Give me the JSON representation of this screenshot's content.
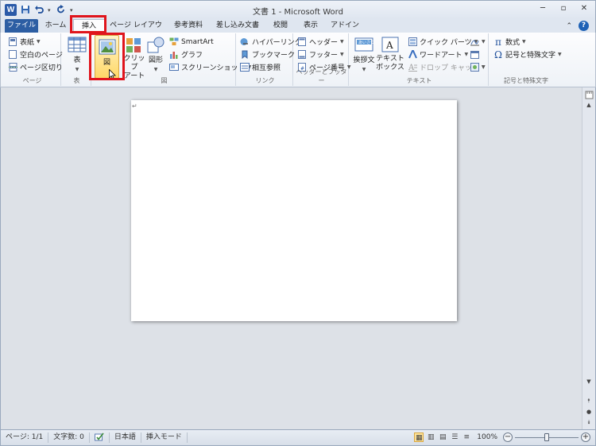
{
  "titlebar": {
    "app_icon": "W",
    "doc_title": "文書 1 - Microsoft Word",
    "quick_access": [
      "save-icon",
      "undo-icon",
      "redo-icon",
      "customize-dropdown-icon"
    ],
    "controls": {
      "minimize": "─",
      "restore": "▫",
      "close": "✕"
    }
  },
  "tabs": [
    {
      "label": "ファイル"
    },
    {
      "label": "ホーム"
    },
    {
      "label": "挿入"
    },
    {
      "label": "ページ レイアウト"
    },
    {
      "label": "参考資料"
    },
    {
      "label": "差し込み文書"
    },
    {
      "label": "校閲"
    },
    {
      "label": "表示"
    },
    {
      "label": "アドイン"
    }
  ],
  "ribbon": {
    "page_group": {
      "label": "ページ",
      "cover": "表紙",
      "blank": "空白のページ",
      "break": "ページ区切り"
    },
    "table_group": {
      "label": "表",
      "table": "表"
    },
    "illustrations_group": {
      "label": "図",
      "picture": "図",
      "clipart": "クリップ\nアート",
      "shapes": "図形",
      "smartart": "SmartArt",
      "chart": "グラフ",
      "screenshot": "スクリーンショット"
    },
    "links_group": {
      "label": "リンク",
      "hyperlink": "ハイパーリンク",
      "bookmark": "ブックマーク",
      "crossref": "相互参照"
    },
    "header_group": {
      "label": "ヘッダーとフッター",
      "header": "ヘッダー",
      "footer": "フッター",
      "page_number": "ページ番号"
    },
    "text_group": {
      "label": "テキスト",
      "greeting": "挨拶文",
      "textbox": "テキスト\nボックス",
      "quickparts": "クイック パーツ",
      "wordart": "ワードアート",
      "dropcap": "ドロップ キャップ"
    },
    "symbols_group": {
      "label": "記号と特殊文字",
      "equation": "数式",
      "symbol": "記号と特殊文字"
    }
  },
  "document": {
    "para_mark": "↵"
  },
  "statusbar": {
    "page": "ページ: 1/1",
    "words": "文字数: 0",
    "language": "日本語",
    "mode": "挿入モード",
    "zoom": "100%",
    "zoom_fraction": 0.5
  }
}
